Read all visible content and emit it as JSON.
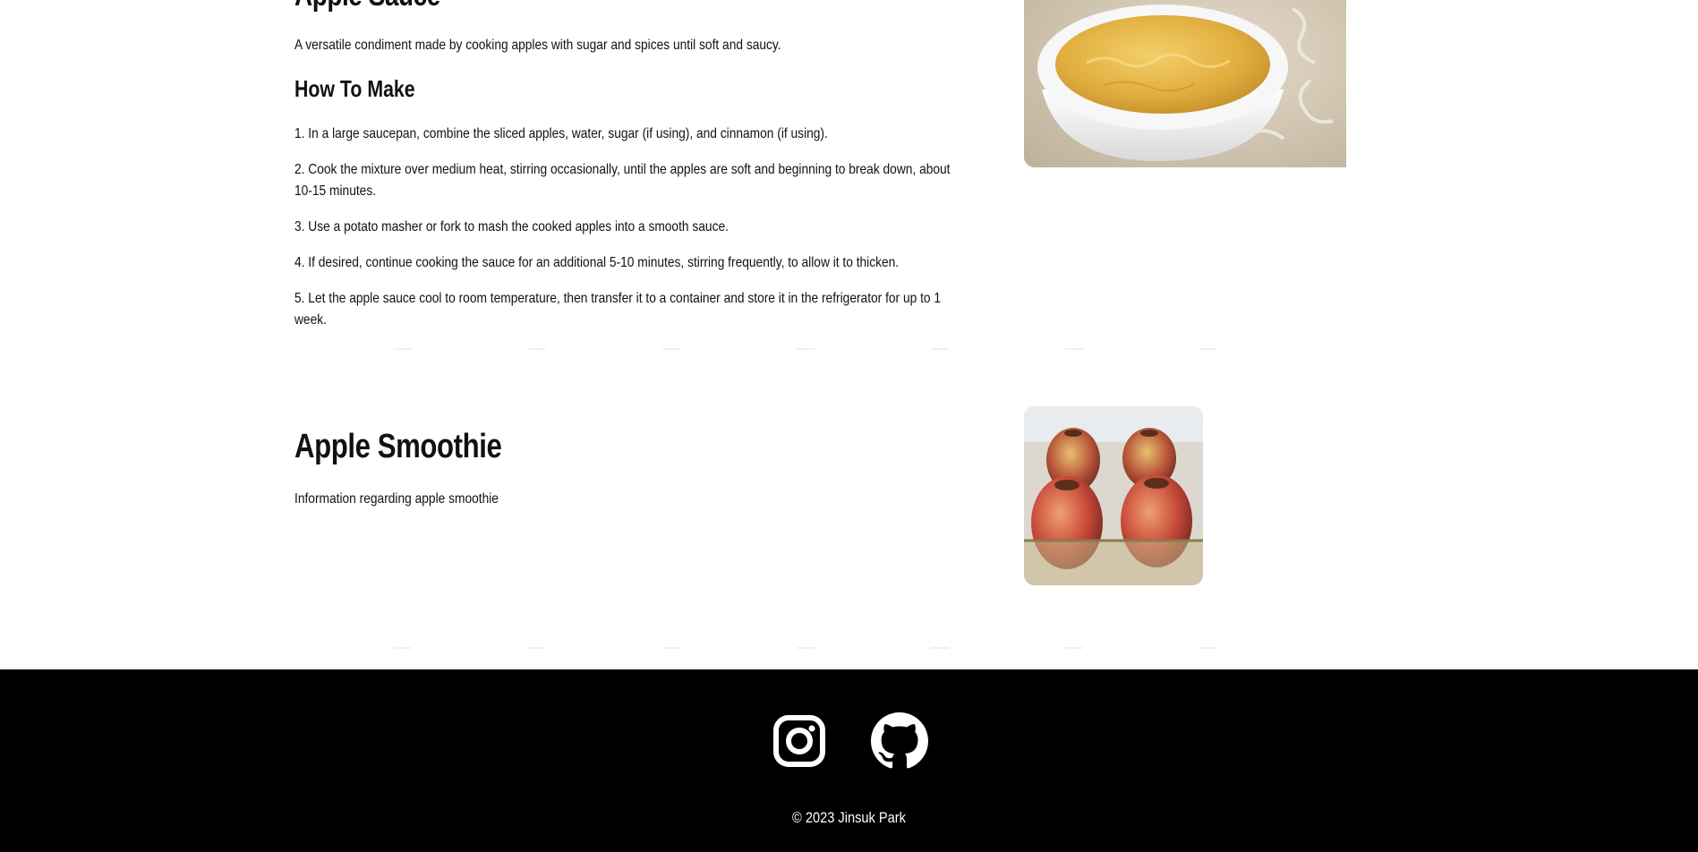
{
  "sections": [
    {
      "title": "Apple Sauce",
      "description": "A versatile condiment made by cooking apples with sugar and spices until soft and saucy.",
      "howto_heading": "How To Make",
      "steps": [
        "1. In a large saucepan, combine the sliced apples, water, sugar (if using), and cinnamon (if using).",
        "2. Cook the mixture over medium heat, stirring occasionally, until the apples are soft and beginning to break down, about 10-15 minutes.",
        "3. Use a potato masher or fork to mash the cooked apples into a smooth sauce.",
        "4. If desired, continue cooking the sauce for an additional 5-10 minutes, stirring frequently, to allow it to thicken.",
        "5. Let the apple sauce cool to room temperature, then transfer it to a container and store it in the refrigerator for up to 1 week."
      ],
      "image_semantic": "apple-sauce-bowl-photo"
    },
    {
      "title": "Apple Smoothie",
      "description": "Information regarding apple smoothie",
      "image_semantic": "baked-apples-photo"
    }
  ],
  "footer": {
    "social": [
      {
        "icon": "instagram-icon"
      },
      {
        "icon": "github-icon"
      }
    ],
    "copyright": "© 2023 Jinsuk Park"
  },
  "colors": {
    "footer_bg": "#000000",
    "footer_text": "#ffffff",
    "body_text": "#111111"
  }
}
